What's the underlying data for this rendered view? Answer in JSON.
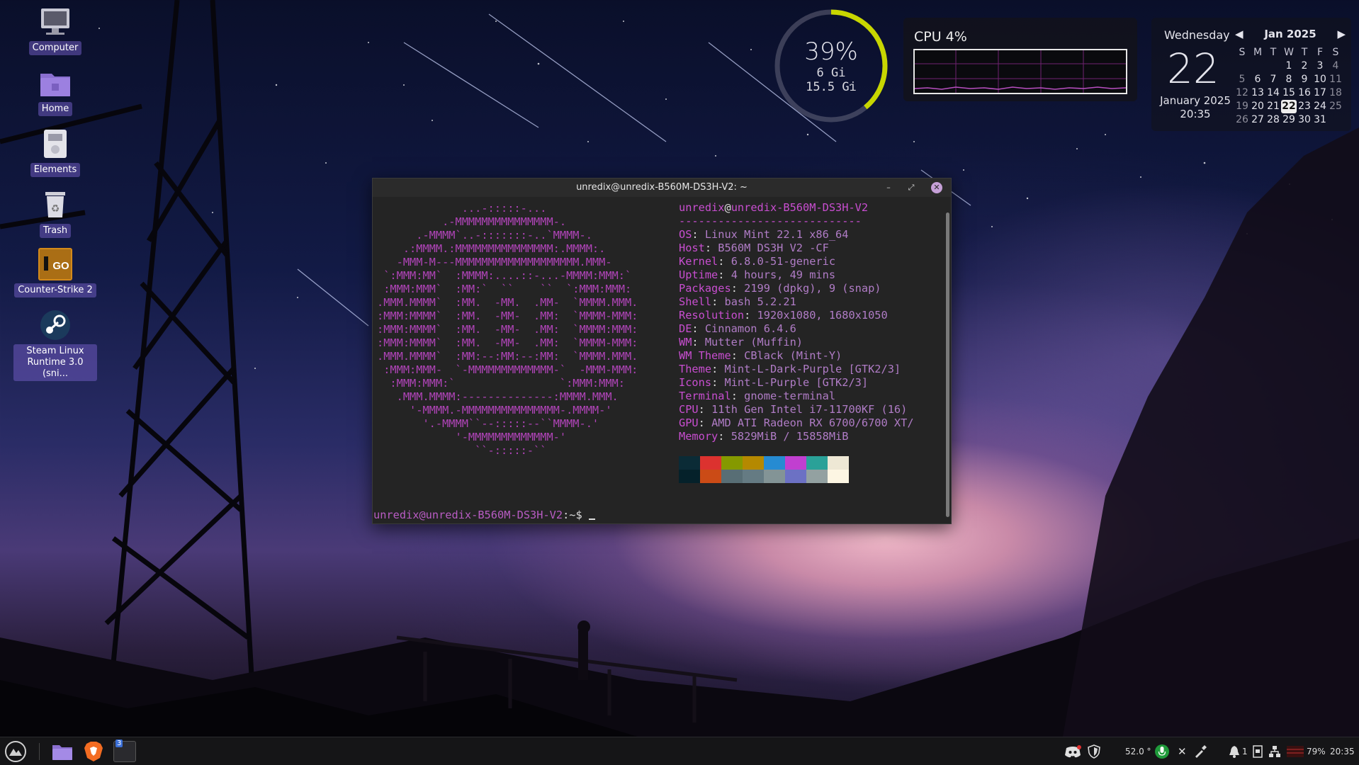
{
  "desktop_icons": [
    {
      "label": "Computer",
      "icon": "computer-icon"
    },
    {
      "label": "Home",
      "icon": "home-folder-icon"
    },
    {
      "label": "Elements",
      "icon": "drive-icon"
    },
    {
      "label": "Trash",
      "icon": "trash-icon"
    },
    {
      "label": "Counter-Strike 2",
      "icon": "counter-strike-icon"
    },
    {
      "label": "Steam Linux Runtime 3.0 (sni...",
      "icon": "steam-icon"
    }
  ],
  "memory_widget": {
    "percent": "39%",
    "used": "6 Gi",
    "total": "15.5 Gi",
    "fill_fraction": 0.39,
    "ring_color": "#c8d600"
  },
  "cpu_widget": {
    "title": "CPU  4%",
    "graph_color": "#b84fc0"
  },
  "calendar": {
    "weekday": "Wednesday",
    "day": "22",
    "month_year": "January 2025",
    "time": "20:35",
    "nav_title": "Jan 2025",
    "prev_icon": "◀",
    "next_icon": "▶",
    "headers": [
      "S",
      "M",
      "T",
      "W",
      "T",
      "F",
      "S"
    ],
    "rows": [
      [
        "",
        "",
        "",
        "1",
        "2",
        "3",
        "4"
      ],
      [
        "5",
        "6",
        "7",
        "8",
        "9",
        "10",
        "11"
      ],
      [
        "12",
        "13",
        "14",
        "15",
        "16",
        "17",
        "18"
      ],
      [
        "19",
        "20",
        "21",
        "22",
        "23",
        "24",
        "25"
      ],
      [
        "26",
        "27",
        "28",
        "29",
        "30",
        "31",
        ""
      ]
    ],
    "today": "22"
  },
  "terminal": {
    "title": "unredix@unredix-B560M-DS3H-V2: ~",
    "minimize": "–",
    "maximize": "⤢",
    "close": "✕",
    "header_user": "unredix",
    "header_at": "@",
    "header_host": "unredix-B560M-DS3H-V2",
    "separator": "----------------------------",
    "info": [
      {
        "key": "OS",
        "value": "Linux Mint 22.1 x86_64"
      },
      {
        "key": "Host",
        "value": "B560M DS3H V2 -CF"
      },
      {
        "key": "Kernel",
        "value": "6.8.0-51-generic"
      },
      {
        "key": "Uptime",
        "value": "4 hours, 49 mins"
      },
      {
        "key": "Packages",
        "value": "2199 (dpkg), 9 (snap)"
      },
      {
        "key": "Shell",
        "value": "bash 5.2.21"
      },
      {
        "key": "Resolution",
        "value": "1920x1080, 1680x1050"
      },
      {
        "key": "DE",
        "value": "Cinnamon 6.4.6"
      },
      {
        "key": "WM",
        "value": "Mutter (Muffin)"
      },
      {
        "key": "WM Theme",
        "value": "CBlack (Mint-Y)"
      },
      {
        "key": "Theme",
        "value": "Mint-L-Dark-Purple [GTK2/3]"
      },
      {
        "key": "Icons",
        "value": "Mint-L-Purple [GTK2/3]"
      },
      {
        "key": "Terminal",
        "value": "gnome-terminal"
      },
      {
        "key": "CPU",
        "value": "11th Gen Intel i7-11700KF (16)"
      },
      {
        "key": "GPU",
        "value": "AMD ATI Radeon RX 6700/6700 XT/"
      },
      {
        "key": "Memory",
        "value": "5829MiB / 15858MiB"
      }
    ],
    "ascii_logo": [
      "             ...-:::::-...",
      "          .-MMMMMMMMMMMMMMM-.",
      "      .-MMMM`..-:::::::-..`MMMM-.",
      "    .:MMMM.:MMMMMMMMMMMMMMM:.MMMM:.",
      "   -MMM-M---MMMMMMMMMMMMMMMMMMM.MMM-",
      " `:MMM:MM`  :MMMM:....::-...-MMMM:MMM:`",
      " :MMM:MMM`  :MM:`  ``    ``  `:MMM:MMM:",
      ".MMM.MMMM`  :MM.  -MM.  .MM-  `MMMM.MMM.",
      ":MMM:MMMM`  :MM.  -MM-  .MM:  `MMMM-MMM:",
      ":MMM:MMMM`  :MM.  -MM-  .MM:  `MMMM:MMM:",
      ":MMM:MMMM`  :MM.  -MM-  .MM:  `MMMM-MMM:",
      ".MMM.MMMM`  :MM:--:MM:--:MM:  `MMMM.MMM.",
      " :MMM:MMM-  `-MMMMMMMMMMMMM-`  -MMM-MMM:",
      "  :MMM:MMM:`                `:MMM:MMM:",
      "   .MMM.MMMM:--------------:MMMM.MMM.",
      "     '-MMMM.-MMMMMMMMMMMMMMM-.MMMM-'",
      "       '.-MMMM``--:::::--``MMMM-.'",
      "            '-MMMMMMMMMMMMM-'",
      "               ``-:::::-``"
    ],
    "palette_top": [
      "#0b2b36",
      "#dc322f",
      "#859900",
      "#b58900",
      "#268bd2",
      "#c13fd0",
      "#2aa198",
      "#eee8d5"
    ],
    "palette_bottom": [
      "#05212a",
      "#cb4b16",
      "#586e75",
      "#657b83",
      "#839496",
      "#6c71c4",
      "#93a1a1",
      "#fdf6e3"
    ],
    "prompt_user": "unredix@unredix-B560M-DS3H-V2",
    "prompt_rest": ":~$ "
  },
  "taskbar": {
    "menu_icon": "mint-menu-icon",
    "apps": [
      {
        "name": "files-icon"
      },
      {
        "name": "brave-icon"
      },
      {
        "name": "terminal-icon",
        "badge": "3"
      }
    ],
    "tray": {
      "temperature": "52.0 °",
      "notifications_count": "1",
      "battery": "79%",
      "clock": "20:35"
    }
  }
}
